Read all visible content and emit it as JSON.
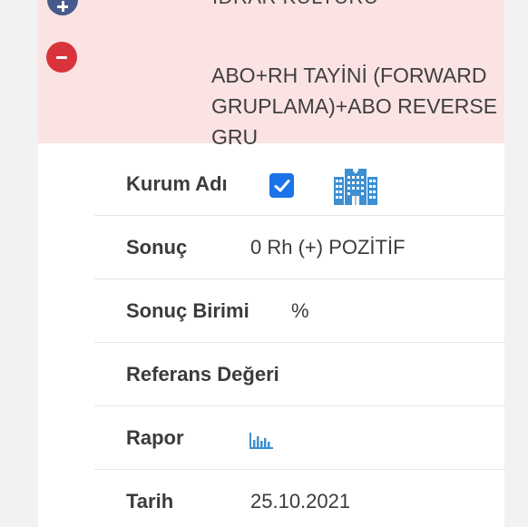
{
  "previous_test": {
    "title": "İDRAR KÜLTÜRÜ"
  },
  "current_test": {
    "title": "ABO+RH TAYİNİ (FORWARD GRUPLAMA)+ABO REVERSE GRU"
  },
  "details": {
    "institution": {
      "label": "Kurum Adı",
      "checked": true,
      "icon": "hospital-icon"
    },
    "result": {
      "label": "Sonuç",
      "value": "0 Rh (+) POZİTİF"
    },
    "unit": {
      "label": "Sonuç Birimi",
      "value": "%"
    },
    "reference": {
      "label": "Referans Değeri",
      "value": ""
    },
    "report": {
      "label": "Rapor",
      "icon": "bar-chart-icon"
    },
    "date": {
      "label": "Tarih",
      "value": "25.10.2021"
    }
  },
  "colors": {
    "header_bg": "#fbe3e4",
    "collapse_button": "#d9333b",
    "expand_button": "#465a8c",
    "accent": "#1a73e8",
    "icon_blue": "#3d8fd1"
  }
}
